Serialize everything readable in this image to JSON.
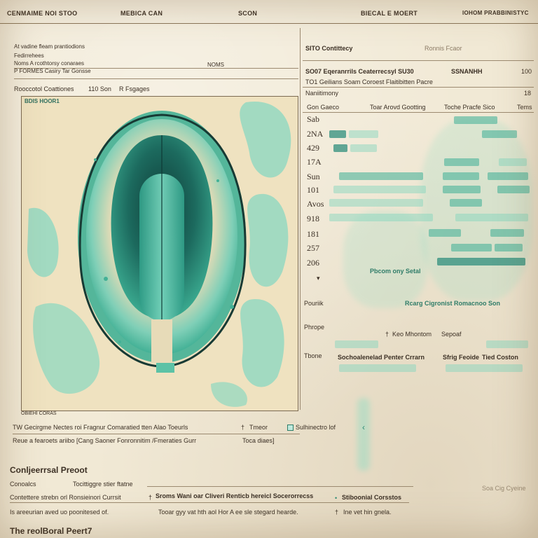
{
  "header": {
    "left": "CENMAIME NOI STOO",
    "medica": "MEBICA CAN",
    "scon": "SCON",
    "report": "BIECAL E MOERT",
    "right": "IOHOM PRABBINISTYC"
  },
  "patient": {
    "line1": "At vadine fleam prantiodions",
    "line2": "Fedirrehees",
    "line3": "Noms A rcothtorsy conaraes",
    "line3_value": "NOMS",
    "line4": "P FORMES Casiry Tar Gonsse",
    "line5_label": "Rooccotol Coattiones",
    "line5_value": "110 Son",
    "line5_extra": "R Fsgages"
  },
  "scan": {
    "label": "BDIS HOOR1",
    "caption": "OBIEHI CORAS"
  },
  "right_panel": {
    "title": "SITO Contittecy",
    "subtitle": "Ronnis Fcaor",
    "row1": "SO07 Eqeranrrils Ceaterrecsyl SU30",
    "row1_mid": "SSNANHH",
    "row1_val": "100",
    "row2": "TO1 Geilians Soam Coroest Flaitibitten Pacre",
    "row3": "Naniitimony",
    "row3_val": "18"
  },
  "table": {
    "headers": [
      "Gon Gaeco",
      "Toar Arovd Gootting",
      "Toche Pracfe Sico",
      "Tems"
    ],
    "rows": [
      "Sab",
      "2NA",
      "429",
      "17A",
      "Sun",
      "101",
      "Avos",
      "918",
      "181",
      "257",
      "206"
    ],
    "footnote": "Pbcom ony Setal"
  },
  "legend": {
    "row1_label": "Pouriik",
    "row1_text": "Rcarg Cigronist Romacnoo Son",
    "row2_label": "Phrope",
    "row2_text": "Keo Mhontom",
    "row2_text2": "Sepoaf",
    "row3_label": "Tbone",
    "row3_col1": "Sochoalenelad Penter Crrarn",
    "row3_col2": "Sfrig Feoide",
    "row3_col3": "Tied Coston"
  },
  "notes": {
    "line1": "TW Gecirgme Nectes roi Fragnur Comaratied tten Alao Toeurls",
    "line1_b": "Tmeor",
    "line1_c": "Sulhinectro lof",
    "line2": "Reue a fearoets ariibo  [Cang Saoner Fonronnitim /Fmeraties Gurr",
    "line2_b": "Toca diaes]"
  },
  "report": {
    "title": "Conljeerrsal Preoot",
    "line1": "Conoalcs",
    "line1_b": "Tocittiggre stier ftatne",
    "line2": "Contettere strebn orl Ronsieinori Currsit",
    "line2_b": "Sroms Wani oar Cliveri Renticb hereicl Socerorrecss",
    "line2_c": "Stiboonial Corsstos",
    "line3": "Is areeurian aved uo poonitesed of.",
    "line3_b": "Tooar gyy vat hth aol Hor A ee sle stegard hearde.",
    "line3_c": "Ine vet hin gnela.",
    "right_note": "Soa Cig Cyeine",
    "footer": "The reolBoral Peert7"
  }
}
